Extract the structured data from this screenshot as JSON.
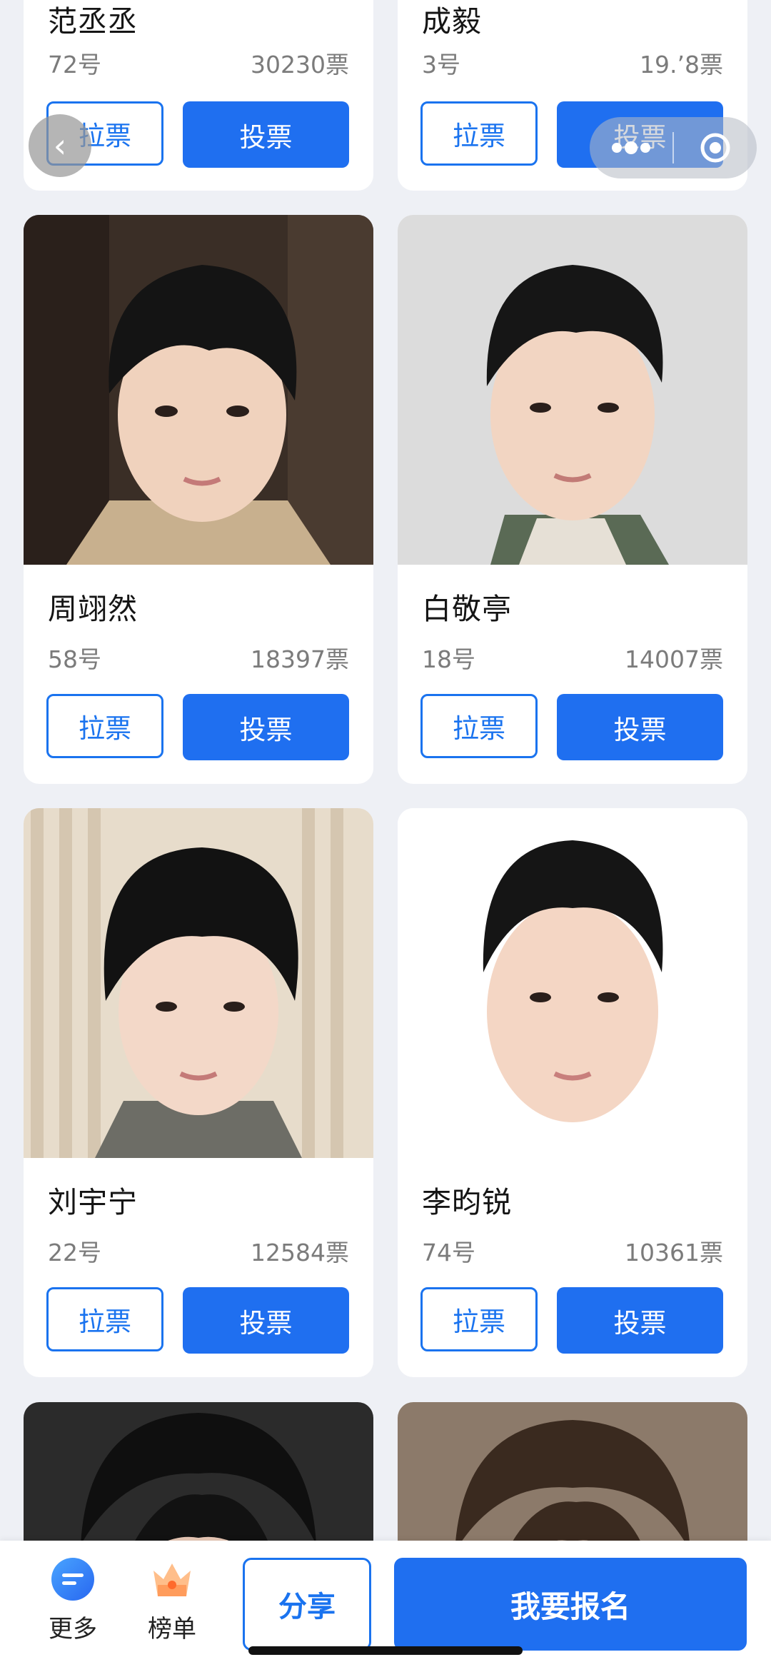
{
  "nav": {
    "back_icon": "chevron-left-icon",
    "more_icon": "more-dots-icon",
    "close_icon": "target-icon"
  },
  "contestants": [
    {
      "name": "范丞丞",
      "number": "72号",
      "votes": "30230票",
      "canvass_label": "拉票",
      "vote_label": "投票"
    },
    {
      "name": "成毅",
      "number": "3号",
      "votes": "19.’8票",
      "canvass_label": "拉票",
      "vote_label": "投票"
    },
    {
      "name": "周翊然",
      "number": "58号",
      "votes": "18397票",
      "canvass_label": "拉票",
      "vote_label": "投票"
    },
    {
      "name": "白敬亭",
      "number": "18号",
      "votes": "14007票",
      "canvass_label": "拉票",
      "vote_label": "投票"
    },
    {
      "name": "刘宇宁",
      "number": "22号",
      "votes": "12584票",
      "canvass_label": "拉票",
      "vote_label": "投票"
    },
    {
      "name": "李昀锐",
      "number": "74号",
      "votes": "10361票",
      "canvass_label": "拉票",
      "vote_label": "投票"
    }
  ],
  "bottom_bar": {
    "more_label": "更多",
    "ranking_label": "榜单",
    "share_label": "分享",
    "signup_label": "我要报名"
  },
  "colors": {
    "accent": "#1f6ff0",
    "background": "#eef0f5"
  }
}
